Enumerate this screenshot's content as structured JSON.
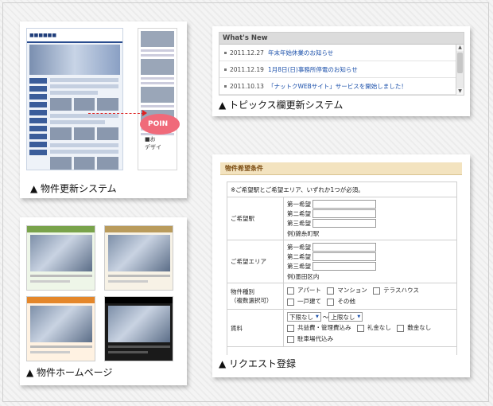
{
  "captions": {
    "property_update": "▲ 物件更新システム",
    "topics_update": "▲ トピックス欄更新システム",
    "property_homepage": "▲ 物件ホームページ",
    "request_register": "▲ リクエスト登録"
  },
  "property_mock": {
    "poi_label": "POIN",
    "poi_sub_1": "■お",
    "poi_sub_2": "デザイ"
  },
  "topics": {
    "heading": "What's New",
    "items": [
      {
        "date": "2011.12.27",
        "title": "年末年始休業のお知らせ"
      },
      {
        "date": "2011.12.19",
        "title": "1月8日(日)事務所停電のお知らせ"
      },
      {
        "date": "2011.10.13",
        "title": "「ナットクWEBサイト」サービスを開始しました！"
      }
    ]
  },
  "form": {
    "title": "物件希望条件",
    "note": "※ご希望駅とご希望エリア、いずれか1つが必須。",
    "station": {
      "label": "ご希望駅",
      "choices": [
        "第一希望",
        "第二希望",
        "第三希望"
      ],
      "example": "例)錦糸町駅"
    },
    "area": {
      "label": "ご希望エリア",
      "choices": [
        "第一希望",
        "第二希望",
        "第三希望"
      ],
      "example": "例)墨田区内"
    },
    "type": {
      "label_1": "物件種別",
      "label_2": "（複数選択可）",
      "options": [
        "アパート",
        "マンション",
        "テラスハウス",
        "一戸建て",
        "その他"
      ]
    },
    "rent": {
      "label": "賃料",
      "min_value": "下限なし",
      "separator": "～",
      "max_value": "上限なし",
      "options": [
        "共益費・管理費込み",
        "礼金なし",
        "敷金なし",
        "駐車場代込み"
      ]
    }
  }
}
